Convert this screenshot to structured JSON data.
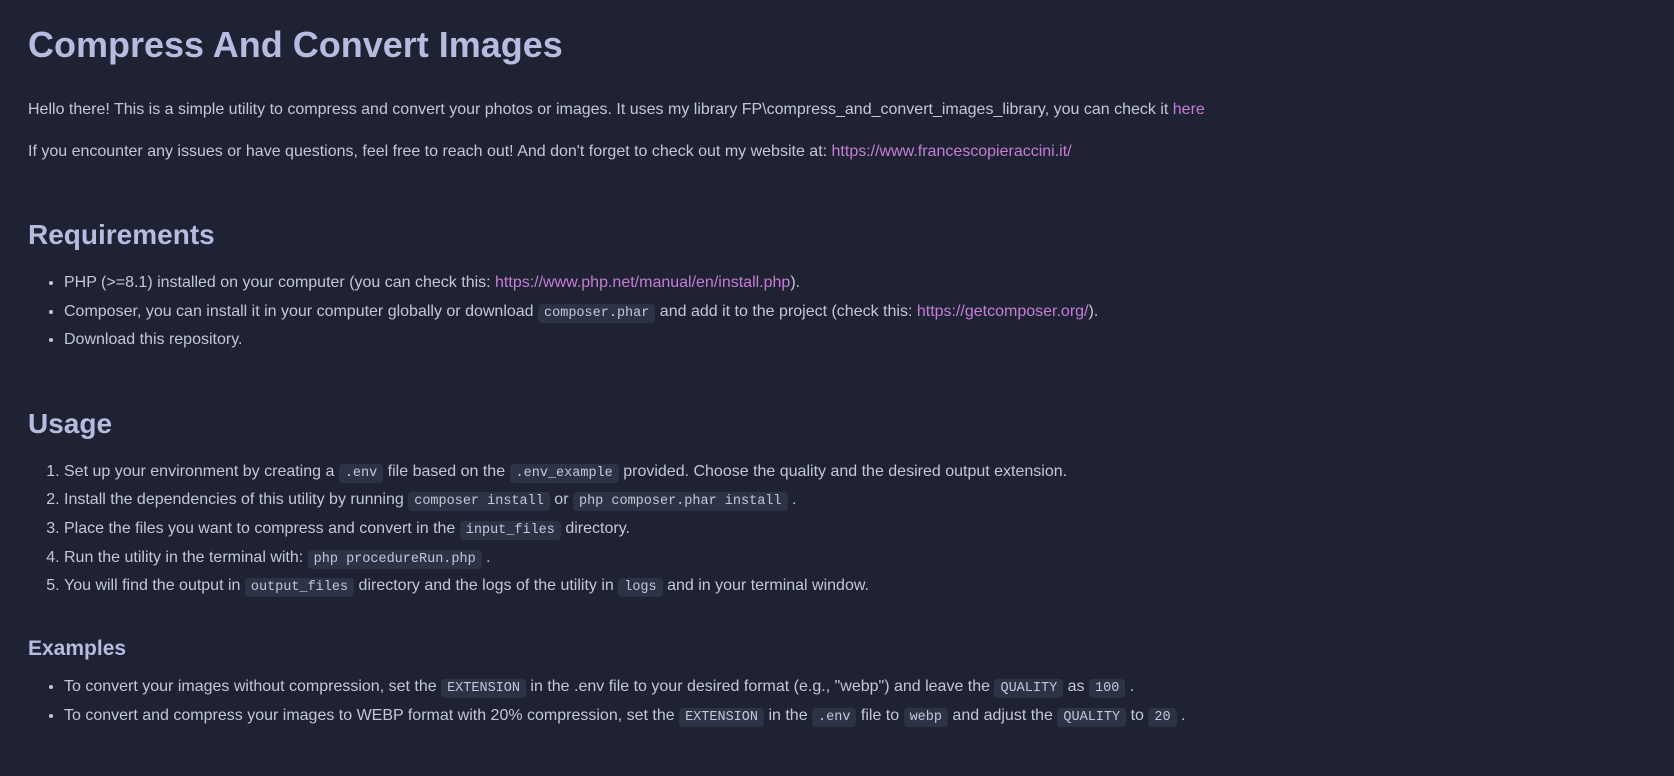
{
  "title": "Compress And Convert Images",
  "intro": {
    "part1": "Hello there! This is a simple utility to compress and convert your photos or images. It uses my library FP\\compress_and_convert_images_library, you can check it ",
    "here_link": "here",
    "part2": "If you encounter any issues or have questions, feel free to reach out! And don't forget to check out my website at: ",
    "website_link": "https://www.francescopieraccini.it/"
  },
  "requirements": {
    "heading": "Requirements",
    "item1": {
      "pre": "PHP (>=8.1) installed on your computer (you can check this: ",
      "link": "https://www.php.net/manual/en/install.php",
      "post": ")."
    },
    "item2": {
      "pre": "Composer, you can install it in your computer globally or download ",
      "code": "composer.phar",
      "mid": " and add it to the project (check this: ",
      "link": "https://getcomposer.org/",
      "post": ")."
    },
    "item3": "Download this repository."
  },
  "usage": {
    "heading": "Usage",
    "step1": {
      "a": "Set up your environment by creating a ",
      "code1": ".env",
      "b": " file based on the ",
      "code2": ".env_example",
      "c": " provided. Choose the quality and the desired output extension."
    },
    "step2": {
      "a": "Install the dependencies of this utility by running ",
      "code1": "composer install",
      "b": " or ",
      "code2": "php composer.phar install",
      "c": " ."
    },
    "step3": {
      "a": "Place the files you want to compress and convert in the ",
      "code1": "input_files",
      "b": " directory."
    },
    "step4": {
      "a": "Run the utility in the terminal with: ",
      "code1": "php procedureRun.php",
      "b": " ."
    },
    "step5": {
      "a": "You will find the output in ",
      "code1": "output_files",
      "b": " directory and the logs of the utility in ",
      "code2": "logs",
      "c": " and in your terminal window."
    }
  },
  "examples": {
    "heading": "Examples",
    "ex1": {
      "a": "To convert your images without compression, set the ",
      "code1": "EXTENSION",
      "b": " in the .env file to your desired format (e.g., \"webp\") and leave the ",
      "code2": "QUALITY",
      "c": " as ",
      "code3": "100",
      "d": " ."
    },
    "ex2": {
      "a": "To convert and compress your images to WEBP format with 20% compression, set the ",
      "code1": "EXTENSION",
      "b": " in the ",
      "code2": ".env",
      "c": " file to ",
      "code3": "webp",
      "d": " and adjust the ",
      "code4": "QUALITY",
      "e": " to ",
      "code5": "20",
      "f": " ."
    }
  }
}
